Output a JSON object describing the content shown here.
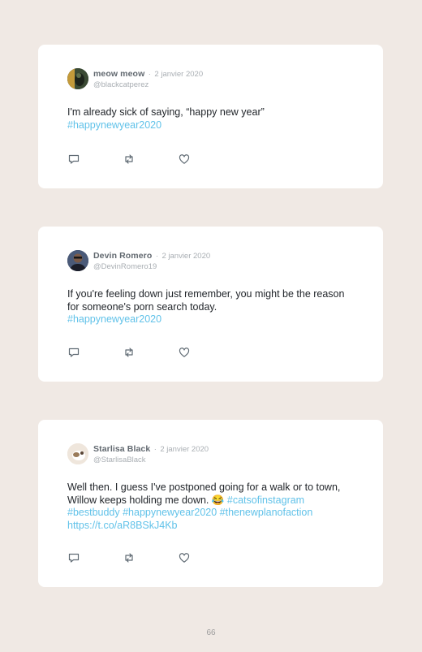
{
  "tweets": [
    {
      "name": "meow meow",
      "separator": "·",
      "date": "2 janvier 2020",
      "handle": "@blackcatperez",
      "text": "I'm already sick of saying, “happy new year”",
      "hashtags": "#happynewyear2020",
      "avatar_color": "#2e3a2a"
    },
    {
      "name": "Devin Romero",
      "separator": "·",
      "date": "2 janvier 2020",
      "handle": "@DevinRomero19",
      "text": "If you're feeling down just remember, you might be the reason for someone's porn search today.",
      "hashtags": "#happynewyear2020",
      "avatar_color": "#2a3550"
    },
    {
      "name": "Starlisa Black",
      "separator": "·",
      "date": "2 janvier 2020",
      "handle": "@StarlisaBlack",
      "text": "Well then. I guess I've postponed going for a walk or to town, Willow keeps holding me down. 😂 ",
      "inline_tag": "#catsofinstagram",
      "hashtags": "#bestbuddy #happynewyear2020 #thenewplanofaction",
      "link": "https://t.co/aR8BSkJ4Kb",
      "avatar_color": "#e9ddd0"
    }
  ],
  "icons": [
    "reply-icon",
    "retweet-icon",
    "like-icon"
  ],
  "page_number": "66"
}
